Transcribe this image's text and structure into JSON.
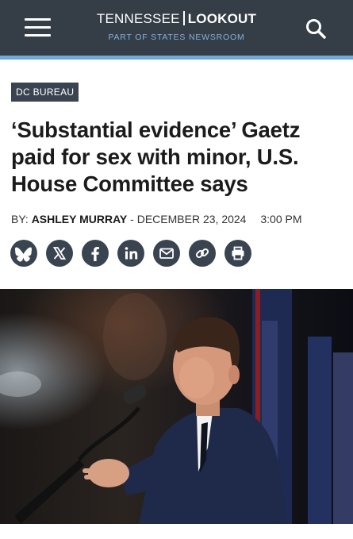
{
  "header": {
    "brand_left": "TENNESSEE",
    "brand_right": "LOOKOUT",
    "tagline": "PART OF STATES NEWSROOM",
    "menu_icon": "hamburger-menu-icon",
    "search_icon": "search-icon"
  },
  "article": {
    "section": "DC BUREAU",
    "headline": "‘Substantial evidence’ Gaetz paid for sex with minor, U.S. House Committee says",
    "by_label": "BY:",
    "author": "ASHLEY MURRAY",
    "date_sep": "-",
    "date": "DECEMBER 23, 2024",
    "time": "3:00 PM"
  },
  "share": [
    {
      "icon": "bluesky-icon"
    },
    {
      "icon": "x-icon"
    },
    {
      "icon": "facebook-icon"
    },
    {
      "icon": "linkedin-icon"
    },
    {
      "icon": "email-icon"
    },
    {
      "icon": "link-icon"
    },
    {
      "icon": "print-icon"
    }
  ],
  "colors": {
    "header_bg": "#353d46",
    "accent_stripe": "#6ea9d8",
    "badge_bg": "#3a4450",
    "share_bg": "#3a4450"
  }
}
